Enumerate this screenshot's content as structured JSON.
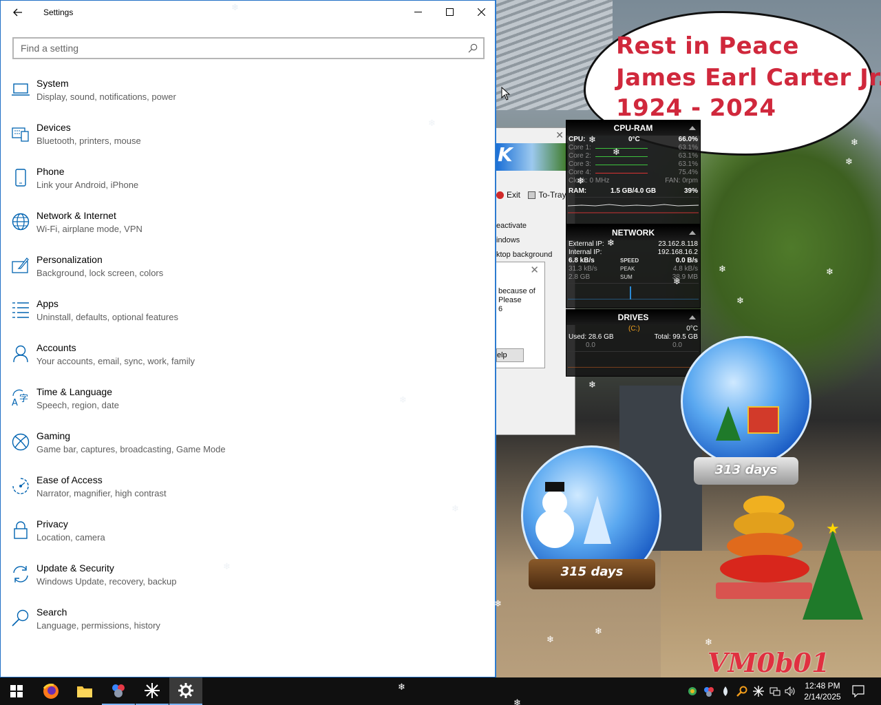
{
  "settings_window": {
    "title": "Settings",
    "search_placeholder": "Find a setting",
    "categories": [
      {
        "name": "System",
        "desc": "Display, sound, notifications, power",
        "icon": "laptop-icon"
      },
      {
        "name": "Devices",
        "desc": "Bluetooth, printers, mouse",
        "icon": "keyboard-icon"
      },
      {
        "name": "Phone",
        "desc": "Link your Android, iPhone",
        "icon": "phone-icon"
      },
      {
        "name": "Network & Internet",
        "desc": "Wi-Fi, airplane mode, VPN",
        "icon": "globe-icon"
      },
      {
        "name": "Personalization",
        "desc": "Background, lock screen, colors",
        "icon": "paintbrush-icon"
      },
      {
        "name": "Apps",
        "desc": "Uninstall, defaults, optional features",
        "icon": "apps-list-icon"
      },
      {
        "name": "Accounts",
        "desc": "Your accounts, email, sync, work, family",
        "icon": "person-icon"
      },
      {
        "name": "Time & Language",
        "desc": "Speech, region, date",
        "icon": "time-language-icon"
      },
      {
        "name": "Gaming",
        "desc": "Game bar, captures, broadcasting, Game Mode",
        "icon": "xbox-icon"
      },
      {
        "name": "Ease of Access",
        "desc": "Narrator, magnifier, high contrast",
        "icon": "ease-of-access-icon"
      },
      {
        "name": "Privacy",
        "desc": "Location, camera",
        "icon": "lock-icon"
      },
      {
        "name": "Update & Security",
        "desc": "Windows Update, recovery, backup",
        "icon": "sync-icon"
      },
      {
        "name": "Search",
        "desc": "Language, permissions, history",
        "icon": "search-icon"
      }
    ]
  },
  "cloud": {
    "line1": "Rest in Peace",
    "line2": "James Earl Carter Jr.",
    "line3": "1924 - 2024"
  },
  "background_app": {
    "banner": "K",
    "exit": "Exit",
    "to_tray": "To-Tray",
    "text1": "eactivate",
    "text2": "indows",
    "text3": "ktop background",
    "dialog_text1": "because of",
    "dialog_text2": "Please",
    "dialog_text3": "6",
    "dialog_button": "elp"
  },
  "cpu_ram": {
    "title": "CPU-RAM",
    "cpu_label": "CPU:",
    "cpu_temp": "0°C",
    "cpu_pct": "66.0%",
    "cores": [
      {
        "label": "Core 1:",
        "value": "63.1%"
      },
      {
        "label": "Core 2:",
        "value": "63.1%"
      },
      {
        "label": "Core 3:",
        "value": "63.1%"
      },
      {
        "label": "Core 4:",
        "value": "75.4%"
      }
    ],
    "clock": "Clock: 0 MHz",
    "fan": "FAN: 0rpm",
    "ram_label": "RAM:",
    "ram_value": "1.5 GB/4.0 GB",
    "ram_pct": "39%"
  },
  "network": {
    "title": "NETWORK",
    "external_label": "External IP:",
    "external_ip": "23.162.8.118",
    "internal_label": "Internal IP:",
    "internal_ip": "192.168.16.2",
    "speed_down": "6.8 kB/s",
    "speed_label": "SPEED",
    "speed_up": "0.0 B/s",
    "peak_down": "31.3 kB/s",
    "peak_label": "PEAK",
    "peak_up": "4.8 kB/s",
    "sum_down": "2.8 GB",
    "sum_label": "SUM",
    "sum_up": "38.9 MB"
  },
  "drives": {
    "title": "DRIVES",
    "drive": "(C:)",
    "temp": "0°C",
    "used": "Used: 28.6 GB",
    "total": "Total: 99.5 GB",
    "read": "0.0",
    "write": "0.0"
  },
  "globes": {
    "left_days": "315 days",
    "right_days": "313 days"
  },
  "watermark": "VM0b01",
  "taskbar": {
    "time": "12:48 PM",
    "date": "2/14/2025"
  }
}
